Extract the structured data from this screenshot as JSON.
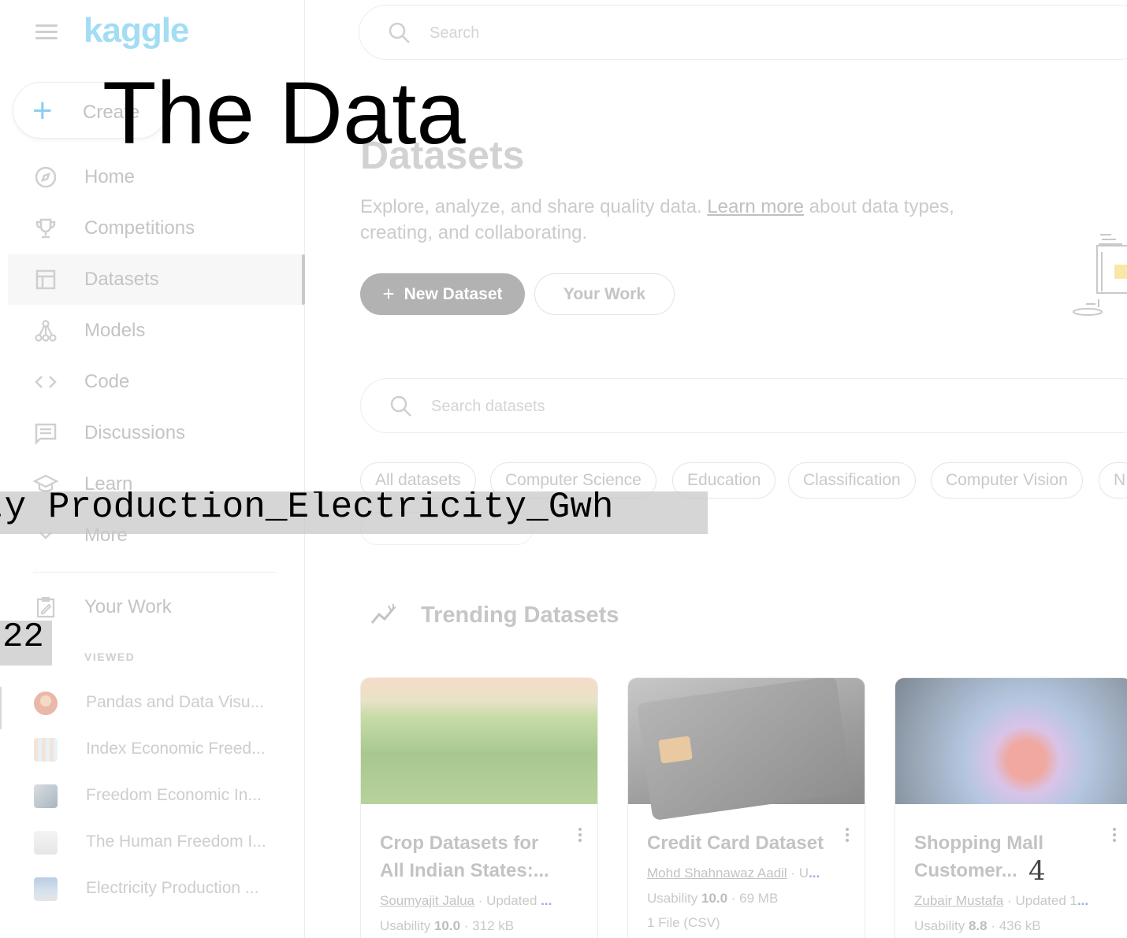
{
  "brand": {
    "logo_text": "kaggle"
  },
  "sidebar": {
    "create_label": "Create",
    "nav": [
      {
        "label": "Home",
        "icon": "compass-icon"
      },
      {
        "label": "Competitions",
        "icon": "trophy-icon"
      },
      {
        "label": "Datasets",
        "icon": "table-icon"
      },
      {
        "label": "Models",
        "icon": "models-icon"
      },
      {
        "label": "Code",
        "icon": "code-icon"
      },
      {
        "label": "Discussions",
        "icon": "discussion-icon"
      },
      {
        "label": "Learn",
        "icon": "school-icon"
      },
      {
        "label": "More",
        "icon": "chevron-down-icon"
      }
    ],
    "your_work_label": "Your Work",
    "viewed_header": "VIEWED",
    "viewed": [
      {
        "label": "Pandas and Data Visu..."
      },
      {
        "label": "Index Economic Freed..."
      },
      {
        "label": "Freedom Economic In..."
      },
      {
        "label": "The Human Freedom I..."
      },
      {
        "label": "Electricity Production ..."
      }
    ]
  },
  "header": {
    "search_placeholder": "Search"
  },
  "main": {
    "title": "Datasets",
    "subtitle_pre": "Explore, analyze, and share quality data. ",
    "subtitle_link": "Learn more",
    "subtitle_post": " about data types, creating, and collaborating.",
    "new_dataset_label": "New Dataset",
    "your_work_label": "Your Work",
    "dataset_search_placeholder": "Search datasets",
    "chips": [
      "All datasets",
      "Computer Science",
      "Education",
      "Classification",
      "Computer Vision",
      "N"
    ],
    "trending_title": "Trending Datasets",
    "cards": [
      {
        "title": "Crop Datasets for All Indian States:...",
        "author": "Soumyajit Jalua",
        "updated": " · Updated ",
        "ellipsis": "...",
        "usability_label": "Usability ",
        "usability": "10.0",
        "size": " · 312 kB"
      },
      {
        "title": "Credit Card Dataset",
        "author": "Mohd Shahnawaz Aadil",
        "updated": " · U",
        "ellipsis": "...",
        "usability_label": "Usability ",
        "usability": "10.0",
        "size": " · 69 MB",
        "files": "1 File (CSV)"
      },
      {
        "title": "Shopping Mall Customer...",
        "author": "Zubair Mustafa",
        "updated": " · Updated 1",
        "ellipsis": "...",
        "usability_label": "Usability ",
        "usability": "8.8",
        "size": " · 436 kB"
      }
    ]
  },
  "overlays": {
    "title": "The Data",
    "code_text": "ty Production_Electricity_Gwh",
    "number": "22",
    "small_number": "4"
  }
}
